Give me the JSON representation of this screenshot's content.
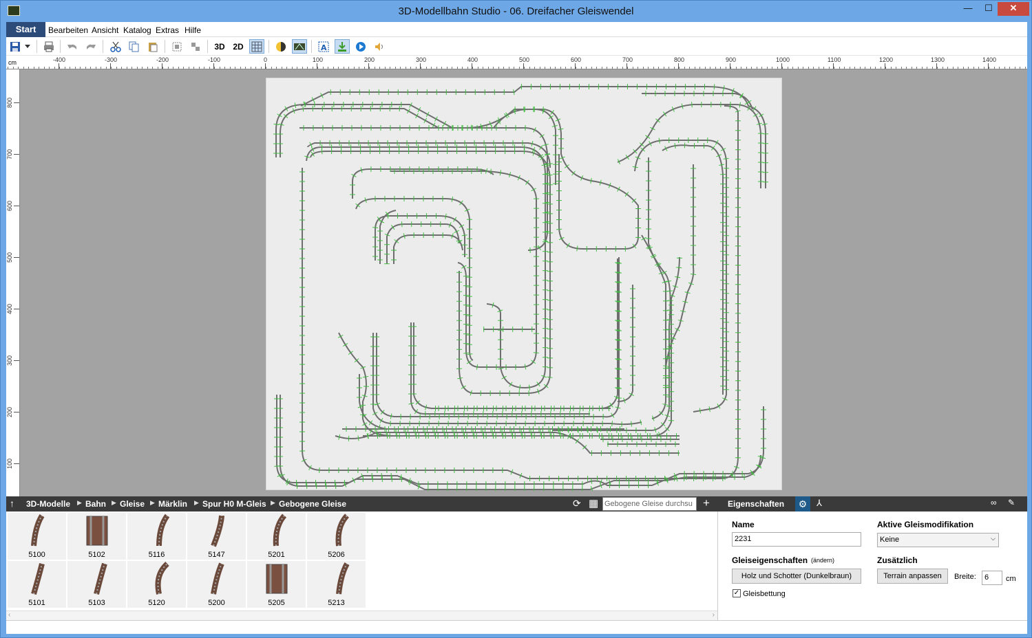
{
  "window": {
    "title": "3D-Modellbahn Studio - 06. Dreifacher Gleiswendel",
    "minimize": "—",
    "maximize": "☐",
    "close": "✕"
  },
  "menu": {
    "start": "Start",
    "items": [
      "Bearbeiten",
      "Ansicht",
      "Katalog",
      "Extras",
      "Hilfe"
    ]
  },
  "toolbar": {
    "btn_3d": "3D",
    "btn_2d": "2D",
    "icons": [
      "save-icon",
      "save-dropdown-icon",
      "print-icon",
      "undo-icon",
      "redo-icon",
      "cut-icon",
      "copy-icon",
      "paste-icon",
      "group-icon",
      "ungroup-icon",
      "grid-icon",
      "layer-icon",
      "terrain-view-icon",
      "text-label-icon",
      "import-icon",
      "play-icon",
      "sound-icon"
    ]
  },
  "ruler": {
    "unit": "cm",
    "top_ticks": [
      "-400",
      "-300",
      "-200",
      "-100",
      "0",
      "100",
      "200",
      "300",
      "400",
      "500",
      "600",
      "700",
      "800",
      "900",
      "1000",
      "1100",
      "1200",
      "1300",
      "1400"
    ],
    "left_ticks": [
      "800",
      "700",
      "600",
      "500",
      "400",
      "300",
      "200",
      "100"
    ]
  },
  "breadcrumb": {
    "items": [
      "3D-Modelle",
      "Bahn",
      "Gleise",
      "Märklin",
      "Spur H0 M-Gleis",
      "Gebogene Gleise"
    ],
    "search_placeholder": "Gebogene Gleise durchsu",
    "panel_title": "Eigenschaften"
  },
  "catalog": {
    "items": [
      "5100",
      "5102",
      "5116",
      "5147",
      "5201",
      "5206",
      "5101",
      "5103",
      "5120",
      "5200",
      "5205",
      "5213"
    ]
  },
  "properties": {
    "name_label": "Name",
    "name_value": "2231",
    "modification_label": "Aktive Gleismodifikation",
    "modification_value": "Keine",
    "track_props_label": "Gleiseigenschaften",
    "track_props_change": "(ändern)",
    "track_props_button": "Holz und Schotter (Dunkelbraun)",
    "extra_label": "Zusätzlich",
    "terrain_button": "Terrain anpassen",
    "width_label": "Breite:",
    "width_value": "6",
    "width_unit": "cm",
    "bedding_label": "Gleisbettung",
    "bedding_checked": true
  },
  "colors": {
    "accent": "#2d4b78",
    "titlebar": "#6ea7e5",
    "track": "#6e6e6e",
    "sleeper": "#3fbf3f",
    "board": "#a3a3a3"
  }
}
